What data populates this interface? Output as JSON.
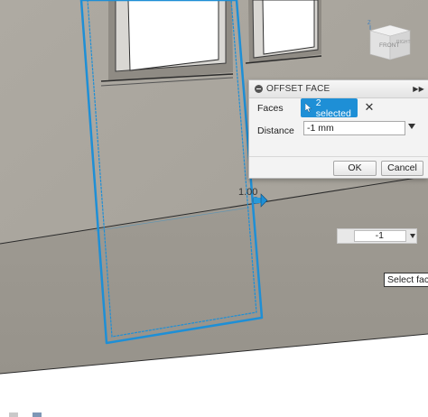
{
  "view_cube": {
    "face_label": "FRONT",
    "side_label": "RIGHT",
    "axis_label": "Z"
  },
  "dialog": {
    "title": "OFFSET FACE",
    "faces_label": "Faces",
    "faces_value": "2 selected",
    "distance_label": "Distance",
    "distance_value": "-1 mm",
    "ok_label": "OK",
    "cancel_label": "Cancel"
  },
  "manipulator": {
    "value": "1.00"
  },
  "canvas_input": {
    "value": "-1"
  },
  "tooltip": {
    "text": "Select fac"
  },
  "colors": {
    "face_fill": "#a9a59d",
    "selection_blue": "#1e8fd6",
    "button_blue": "#1e8fd6",
    "edge_dark": "#2b2b2b"
  },
  "icons": [
    "collapse-icon",
    "expand-icon",
    "cursor-icon",
    "close-icon",
    "chevron-down-icon",
    "arrow-manipulator-icon",
    "view-cube-icon"
  ]
}
